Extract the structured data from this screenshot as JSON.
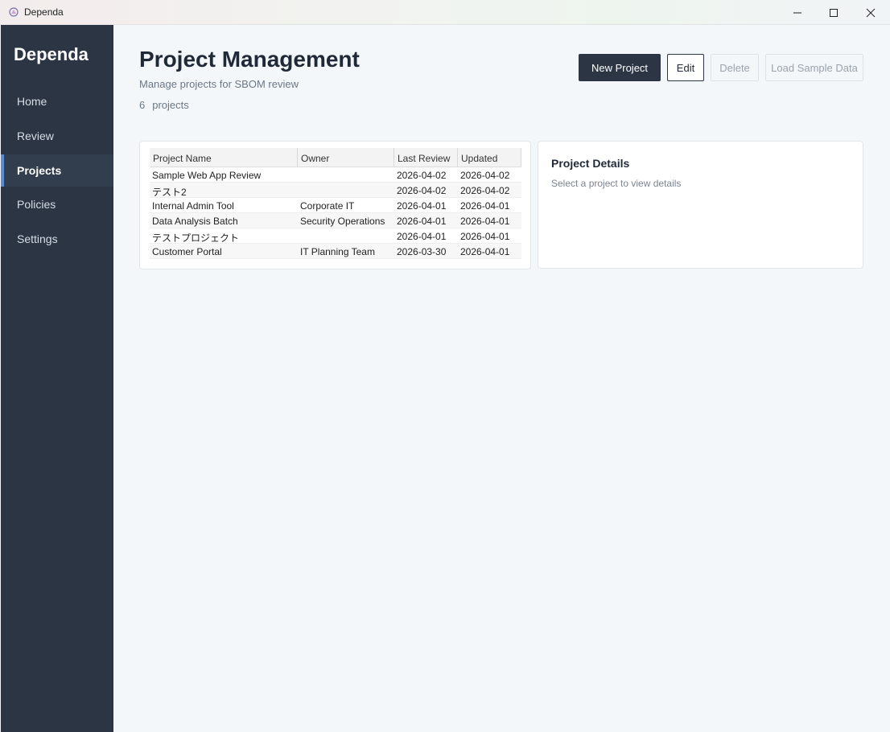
{
  "window": {
    "title": "Dependa",
    "icon": "app-icon",
    "controls": [
      "minimize-icon",
      "maximize-icon",
      "close-icon"
    ]
  },
  "sidebar": {
    "brand": "Dependa",
    "items": [
      {
        "label": "Home",
        "active": false
      },
      {
        "label": "Review",
        "active": false
      },
      {
        "label": "Projects",
        "active": true
      },
      {
        "label": "Policies",
        "active": false
      },
      {
        "label": "Settings",
        "active": false
      }
    ]
  },
  "header": {
    "title": "Project Management",
    "subtitle": "Manage projects for SBOM review",
    "count": "6",
    "count_label": "projects"
  },
  "toolbar": {
    "new_label": "New Project",
    "edit_label": "Edit",
    "delete_label": "Delete",
    "sample_label": "Load Sample Data"
  },
  "table": {
    "columns": [
      "Project Name",
      "Owner",
      "Last Review",
      "Updated"
    ],
    "rows": [
      [
        "Sample Web App Review",
        "",
        "2026-04-02",
        "2026-04-02"
      ],
      [
        "テスト2",
        "",
        "2026-04-02",
        "2026-04-02"
      ],
      [
        "Internal Admin Tool",
        "Corporate IT",
        "2026-04-01",
        "2026-04-01"
      ],
      [
        "Data Analysis Batch",
        "Security Operations",
        "2026-04-01",
        "2026-04-01"
      ],
      [
        "テストプロジェクト",
        "",
        "2026-04-01",
        "2026-04-01"
      ],
      [
        "Customer Portal",
        "IT Planning Team",
        "2026-03-30",
        "2026-04-01"
      ]
    ]
  },
  "details": {
    "title": "Project Details",
    "hint": "Select a project to view details"
  },
  "colors": {
    "sidebar_bg": "#2b3544",
    "primary": "#2b3544",
    "page_bg": "#f4f7fa"
  }
}
